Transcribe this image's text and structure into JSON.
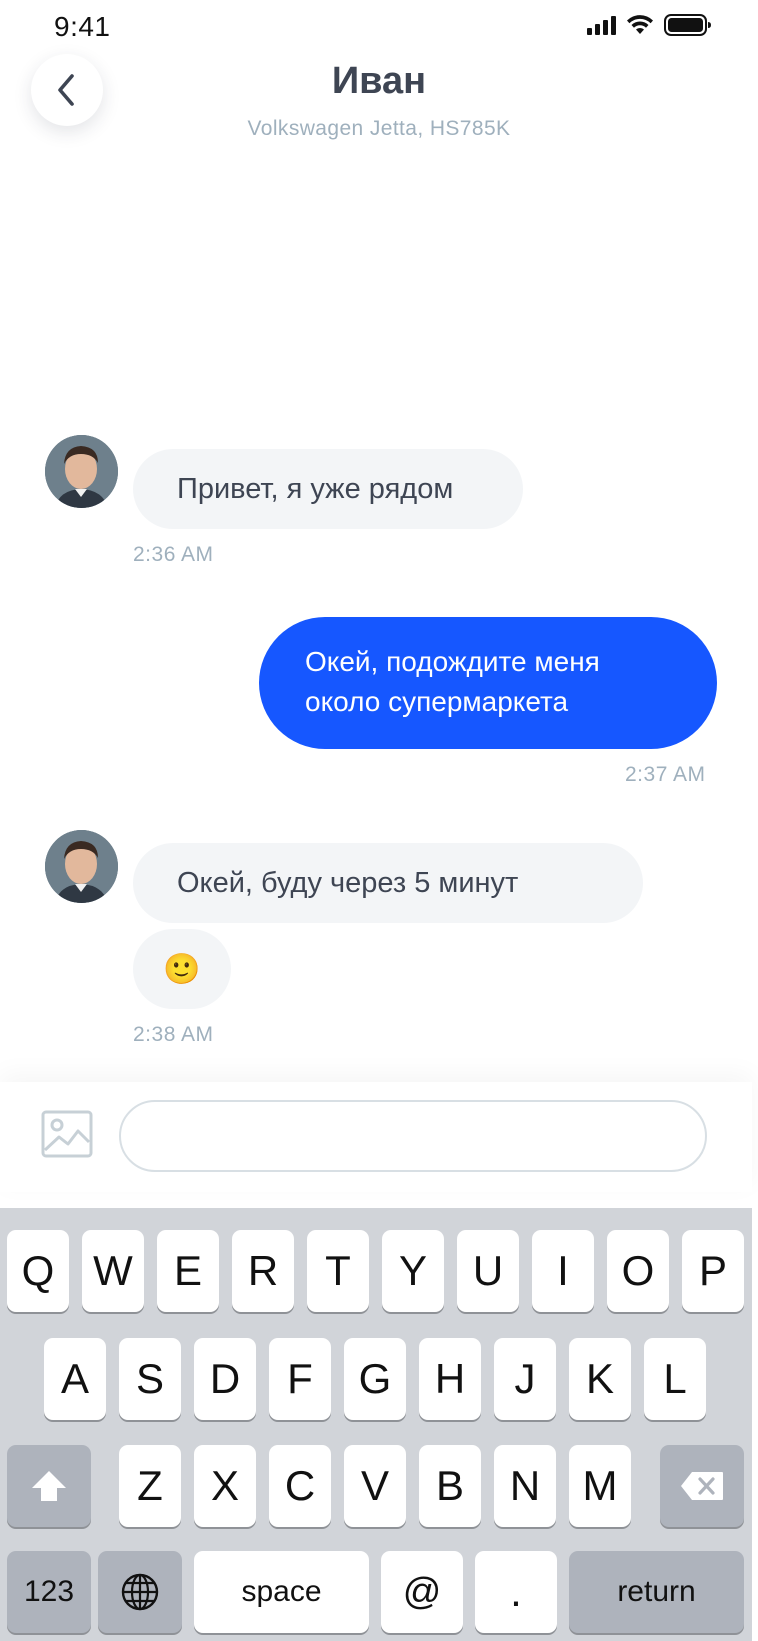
{
  "status": {
    "time": "9:41"
  },
  "header": {
    "name": "Иван",
    "vehicle": "Volkswagen Jetta, HS785K"
  },
  "messages": [
    {
      "text": "Привет, я уже рядом",
      "time": "2:36 AM"
    },
    {
      "line1": "Окей, подождите меня",
      "line2": "около супермаркета",
      "time": "2:37 AM"
    },
    {
      "text": "Окей, буду через 5 минут",
      "emoji": "🙂",
      "time": "2:38 AM"
    }
  ],
  "composer": {
    "value": "",
    "placeholder": ""
  },
  "keyboard": {
    "row1": [
      "Q",
      "W",
      "E",
      "R",
      "T",
      "Y",
      "U",
      "I",
      "O",
      "P"
    ],
    "row2": [
      "A",
      "S",
      "D",
      "F",
      "G",
      "H",
      "J",
      "K",
      "L"
    ],
    "row3": [
      "Z",
      "X",
      "C",
      "V",
      "B",
      "N",
      "M"
    ],
    "numbers": "123",
    "space": "space",
    "at": "@",
    "dot": ".",
    "return": "return"
  },
  "colors": {
    "accent": "#1657ff",
    "bubble_incoming": "#f3f5f7",
    "muted": "#9fb0bd",
    "text": "#3e4553",
    "keyboard_bg": "#d1d4d9"
  },
  "icons": [
    "back-chevron-icon",
    "image-icon",
    "shift-icon",
    "backspace-icon",
    "globe-icon",
    "signal-icon",
    "wifi-icon",
    "battery-icon"
  ]
}
